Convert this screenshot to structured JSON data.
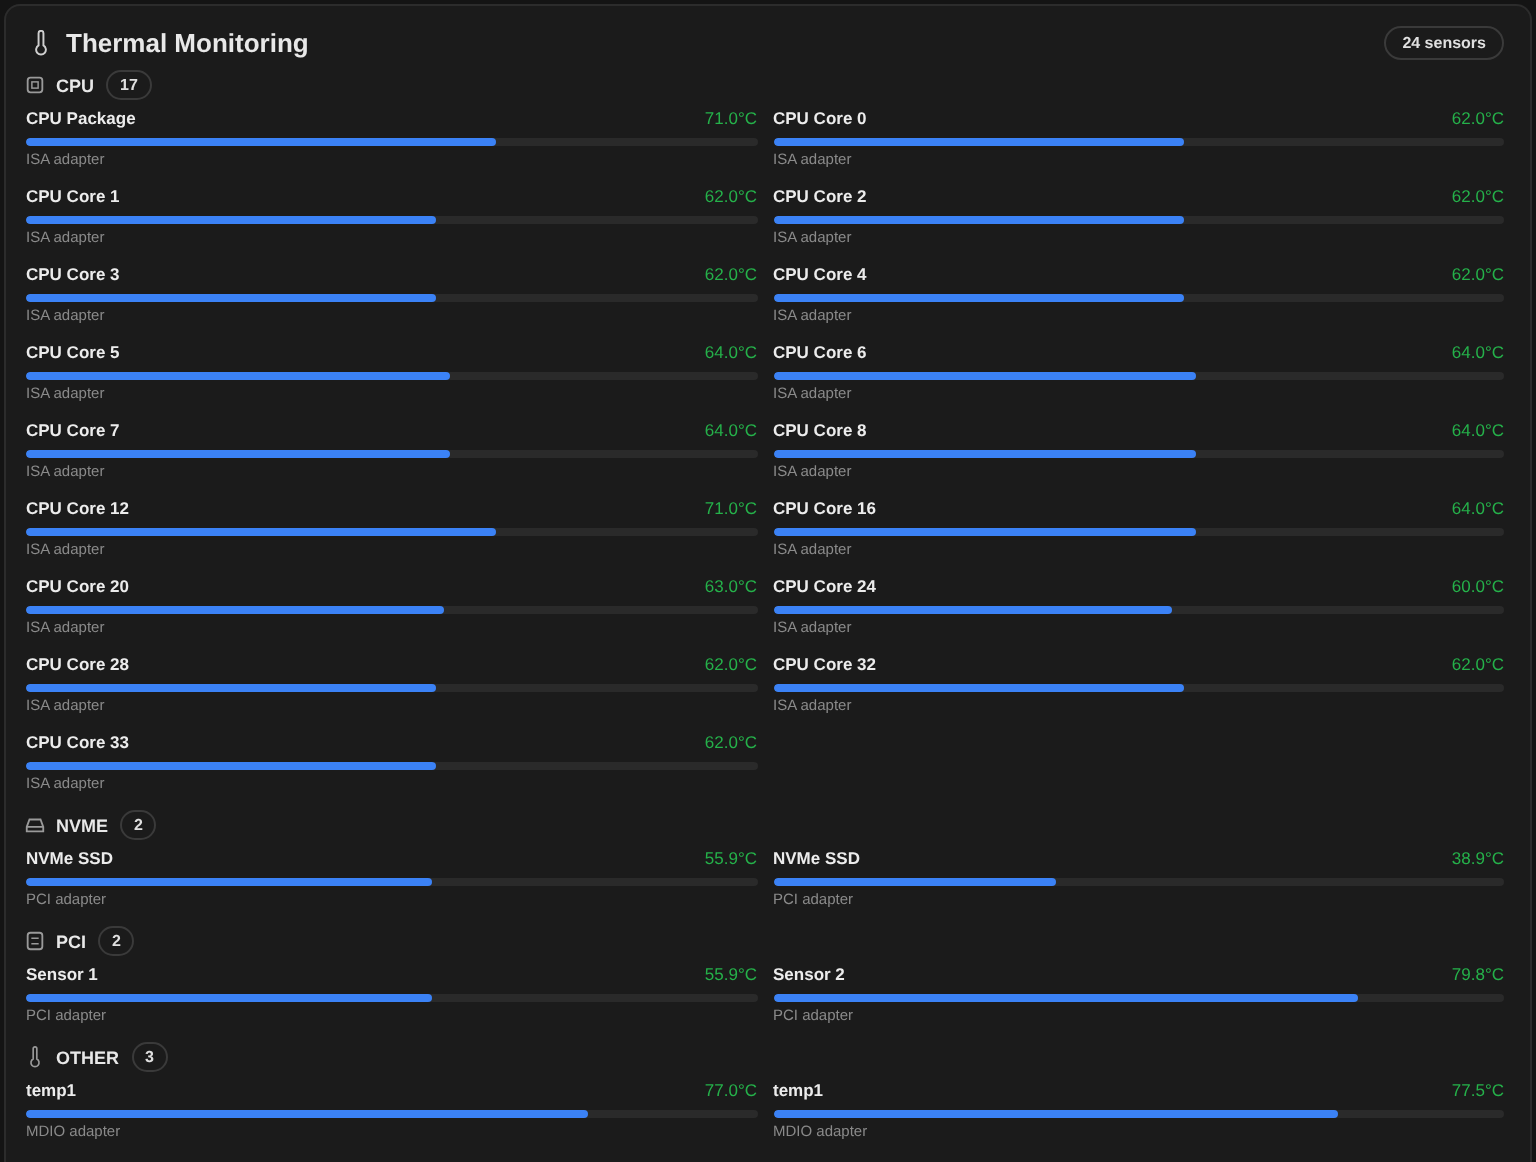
{
  "title": "Thermal Monitoring",
  "sensor_count": "24 sensors",
  "groups": [
    {
      "kind": "cpu",
      "label": "CPU",
      "count": "17",
      "sensors": [
        {
          "name": "CPU Package",
          "temp": "71.0°C",
          "adapter": "ISA adapter",
          "level": 0.643
        },
        {
          "name": "CPU Core 0",
          "temp": "62.0°C",
          "adapter": "ISA adapter",
          "level": 0.561
        },
        {
          "name": "CPU Core 1",
          "temp": "62.0°C",
          "adapter": "ISA adapter",
          "level": 0.561
        },
        {
          "name": "CPU Core 2",
          "temp": "62.0°C",
          "adapter": "ISA adapter",
          "level": 0.561
        },
        {
          "name": "CPU Core 3",
          "temp": "62.0°C",
          "adapter": "ISA adapter",
          "level": 0.561
        },
        {
          "name": "CPU Core 4",
          "temp": "62.0°C",
          "adapter": "ISA adapter",
          "level": 0.561
        },
        {
          "name": "CPU Core 5",
          "temp": "64.0°C",
          "adapter": "ISA adapter",
          "level": 0.58
        },
        {
          "name": "CPU Core 6",
          "temp": "64.0°C",
          "adapter": "ISA adapter",
          "level": 0.58
        },
        {
          "name": "CPU Core 7",
          "temp": "64.0°C",
          "adapter": "ISA adapter",
          "level": 0.58
        },
        {
          "name": "CPU Core 8",
          "temp": "64.0°C",
          "adapter": "ISA adapter",
          "level": 0.58
        },
        {
          "name": "CPU Core 12",
          "temp": "71.0°C",
          "adapter": "ISA adapter",
          "level": 0.643
        },
        {
          "name": "CPU Core 16",
          "temp": "64.0°C",
          "adapter": "ISA adapter",
          "level": 0.58
        },
        {
          "name": "CPU Core 20",
          "temp": "63.0°C",
          "adapter": "ISA adapter",
          "level": 0.572
        },
        {
          "name": "CPU Core 24",
          "temp": "60.0°C",
          "adapter": "ISA adapter",
          "level": 0.545
        },
        {
          "name": "CPU Core 28",
          "temp": "62.0°C",
          "adapter": "ISA adapter",
          "level": 0.561
        },
        {
          "name": "CPU Core 32",
          "temp": "62.0°C",
          "adapter": "ISA adapter",
          "level": 0.561
        },
        {
          "name": "CPU Core 33",
          "temp": "62.0°C",
          "adapter": "ISA adapter",
          "level": 0.561
        }
      ]
    },
    {
      "kind": "drive",
      "label": "NVME",
      "count": "2",
      "sensors": [
        {
          "name": "NVMe SSD",
          "temp": "55.9°C",
          "adapter": "PCI adapter",
          "level": 0.556
        },
        {
          "name": "NVMe SSD",
          "temp": "38.9°C",
          "adapter": "PCI adapter",
          "level": 0.387
        }
      ]
    },
    {
      "kind": "chip",
      "label": "PCI",
      "count": "2",
      "sensors": [
        {
          "name": "Sensor 1",
          "temp": "55.9°C",
          "adapter": "PCI adapter",
          "level": 0.556
        },
        {
          "name": "Sensor 2",
          "temp": "79.8°C",
          "adapter": "PCI adapter",
          "level": 0.8
        }
      ]
    },
    {
      "kind": "thermo",
      "label": "OTHER",
      "count": "3",
      "sensors": [
        {
          "name": "temp1",
          "temp": "77.0°C",
          "adapter": "MDIO adapter",
          "level": 0.768
        },
        {
          "name": "temp1",
          "temp": "77.5°C",
          "adapter": "MDIO adapter",
          "level": 0.774
        }
      ]
    }
  ]
}
